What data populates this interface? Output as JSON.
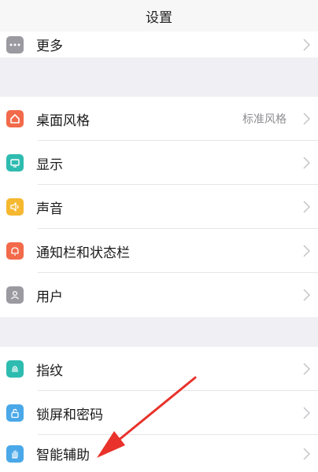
{
  "header": {
    "title": "设置"
  },
  "items": {
    "more": {
      "label": "更多",
      "icon": "more-icon",
      "color": "#9a9aa0"
    },
    "desktop": {
      "label": "桌面风格",
      "value": "标准风格",
      "icon": "home-icon",
      "color": "#f26a4a"
    },
    "display": {
      "label": "显示",
      "icon": "display-icon",
      "color": "#2fbcb0"
    },
    "sound": {
      "label": "声音",
      "icon": "speaker-icon",
      "color": "#f5b830"
    },
    "notify": {
      "label": "通知栏和状态栏",
      "icon": "bell-icon",
      "color": "#f26a4a"
    },
    "user": {
      "label": "用户",
      "icon": "user-icon",
      "color": "#9a9aa0"
    },
    "fingerprint": {
      "label": "指纹",
      "icon": "fingerprint-icon",
      "color": "#2fbcb0"
    },
    "lock": {
      "label": "锁屏和密码",
      "icon": "lock-icon",
      "color": "#4aa8e8"
    },
    "assist": {
      "label": "智能辅助",
      "icon": "hand-icon",
      "color": "#4aa8e8"
    }
  },
  "annotation": {
    "color": "#e8322b",
    "icon": "red-arrow"
  }
}
